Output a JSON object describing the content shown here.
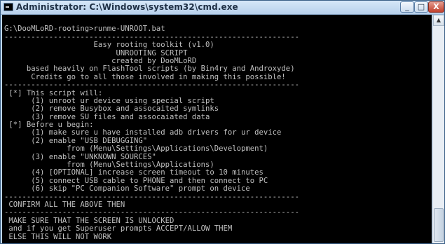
{
  "window": {
    "title": "Administrator: C:\\Windows\\system32\\cmd.exe",
    "icon": "cmd-icon"
  },
  "controls": {
    "minimize": "_",
    "maximize": "□",
    "close": "X"
  },
  "scrollbar": {
    "up_arrow": "▲"
  },
  "console": {
    "lines": [
      "",
      "G:\\DooMLoRD-rooting>runme-UNROOT.bat",
      "------------------------------------------------------------------",
      "                    Easy rooting toolkit (v1.0)",
      "                         UNROOTING SCRIPT",
      "                        created by DooMLoRD",
      "     based heavily on FlashTool scripts (by Bin4ry and Androxyde)",
      "      Credits go to all those involved in making this possible!",
      "------------------------------------------------------------------",
      " [*] This script will:",
      "      (1) unroot ur device using special script",
      "      (2) remove Busybox and assocaited symlinks",
      "      (3) remove SU files and assocaiated data",
      " [*] Before u begin:",
      "      (1) make sure u have installed adb drivers for ur device",
      "      (2) enable \"USB DEBUGGING\"",
      "              from (Menu\\Settings\\Applications\\Development)",
      "      (3) enable \"UNKNOWN SOURCES\"",
      "              from (Menu\\Settings\\Applications)",
      "      (4) [OPTIONAL] increase screen timeout to 10 minutes",
      "      (5) connect USB cable to PHONE and then connect to PC",
      "      (6) skip \"PC Companion Software\" prompt on device",
      "------------------------------------------------------------------",
      " CONFIRM ALL THE ABOVE THEN",
      "------------------------------------------------------------------",
      " MAKE SURE THAT THE SCREEN IS UNLOCKED",
      " and if you get Superuser prompts ACCEPT/ALLOW THEM",
      " ELSE THIS WILL NOT WORK",
      "------------------------------------------------------------------"
    ]
  }
}
